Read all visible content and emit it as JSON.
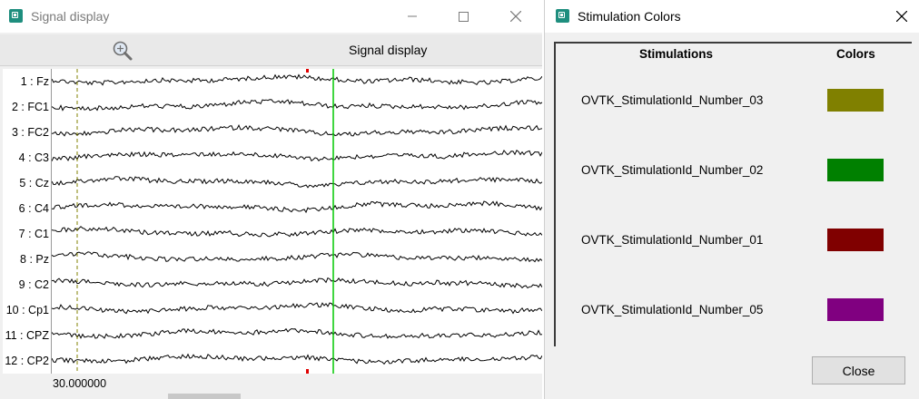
{
  "left_window": {
    "title": "Signal display",
    "toolbar_title": "Signal display",
    "channels": [
      "1 : Fz",
      "2 : FC1",
      "3 : FC2",
      "4 : C3",
      "5 : Cz",
      "6 : C4",
      "7 : C1",
      "8 : Pz",
      "9 : C2",
      "10 : Cp1",
      "11 : CPZ",
      "12 : CP2"
    ],
    "time_label": "30.000000",
    "marker_colors": {
      "dashed": "#808000",
      "solid": "#00c800",
      "tick": "#e00000"
    },
    "icons": [
      "zoom-icon",
      "minimize-icon",
      "maximize-icon",
      "close-icon"
    ]
  },
  "right_window": {
    "title": "Stimulation Colors",
    "headers": {
      "stimulations": "Stimulations",
      "colors": "Colors"
    },
    "rows": [
      {
        "name": "OVTK_StimulationId_Number_03",
        "color": "#808000"
      },
      {
        "name": "OVTK_StimulationId_Number_02",
        "color": "#008000"
      },
      {
        "name": "OVTK_StimulationId_Number_01",
        "color": "#800000"
      },
      {
        "name": "OVTK_StimulationId_Number_05",
        "color": "#800080"
      }
    ],
    "close_label": "Close"
  }
}
